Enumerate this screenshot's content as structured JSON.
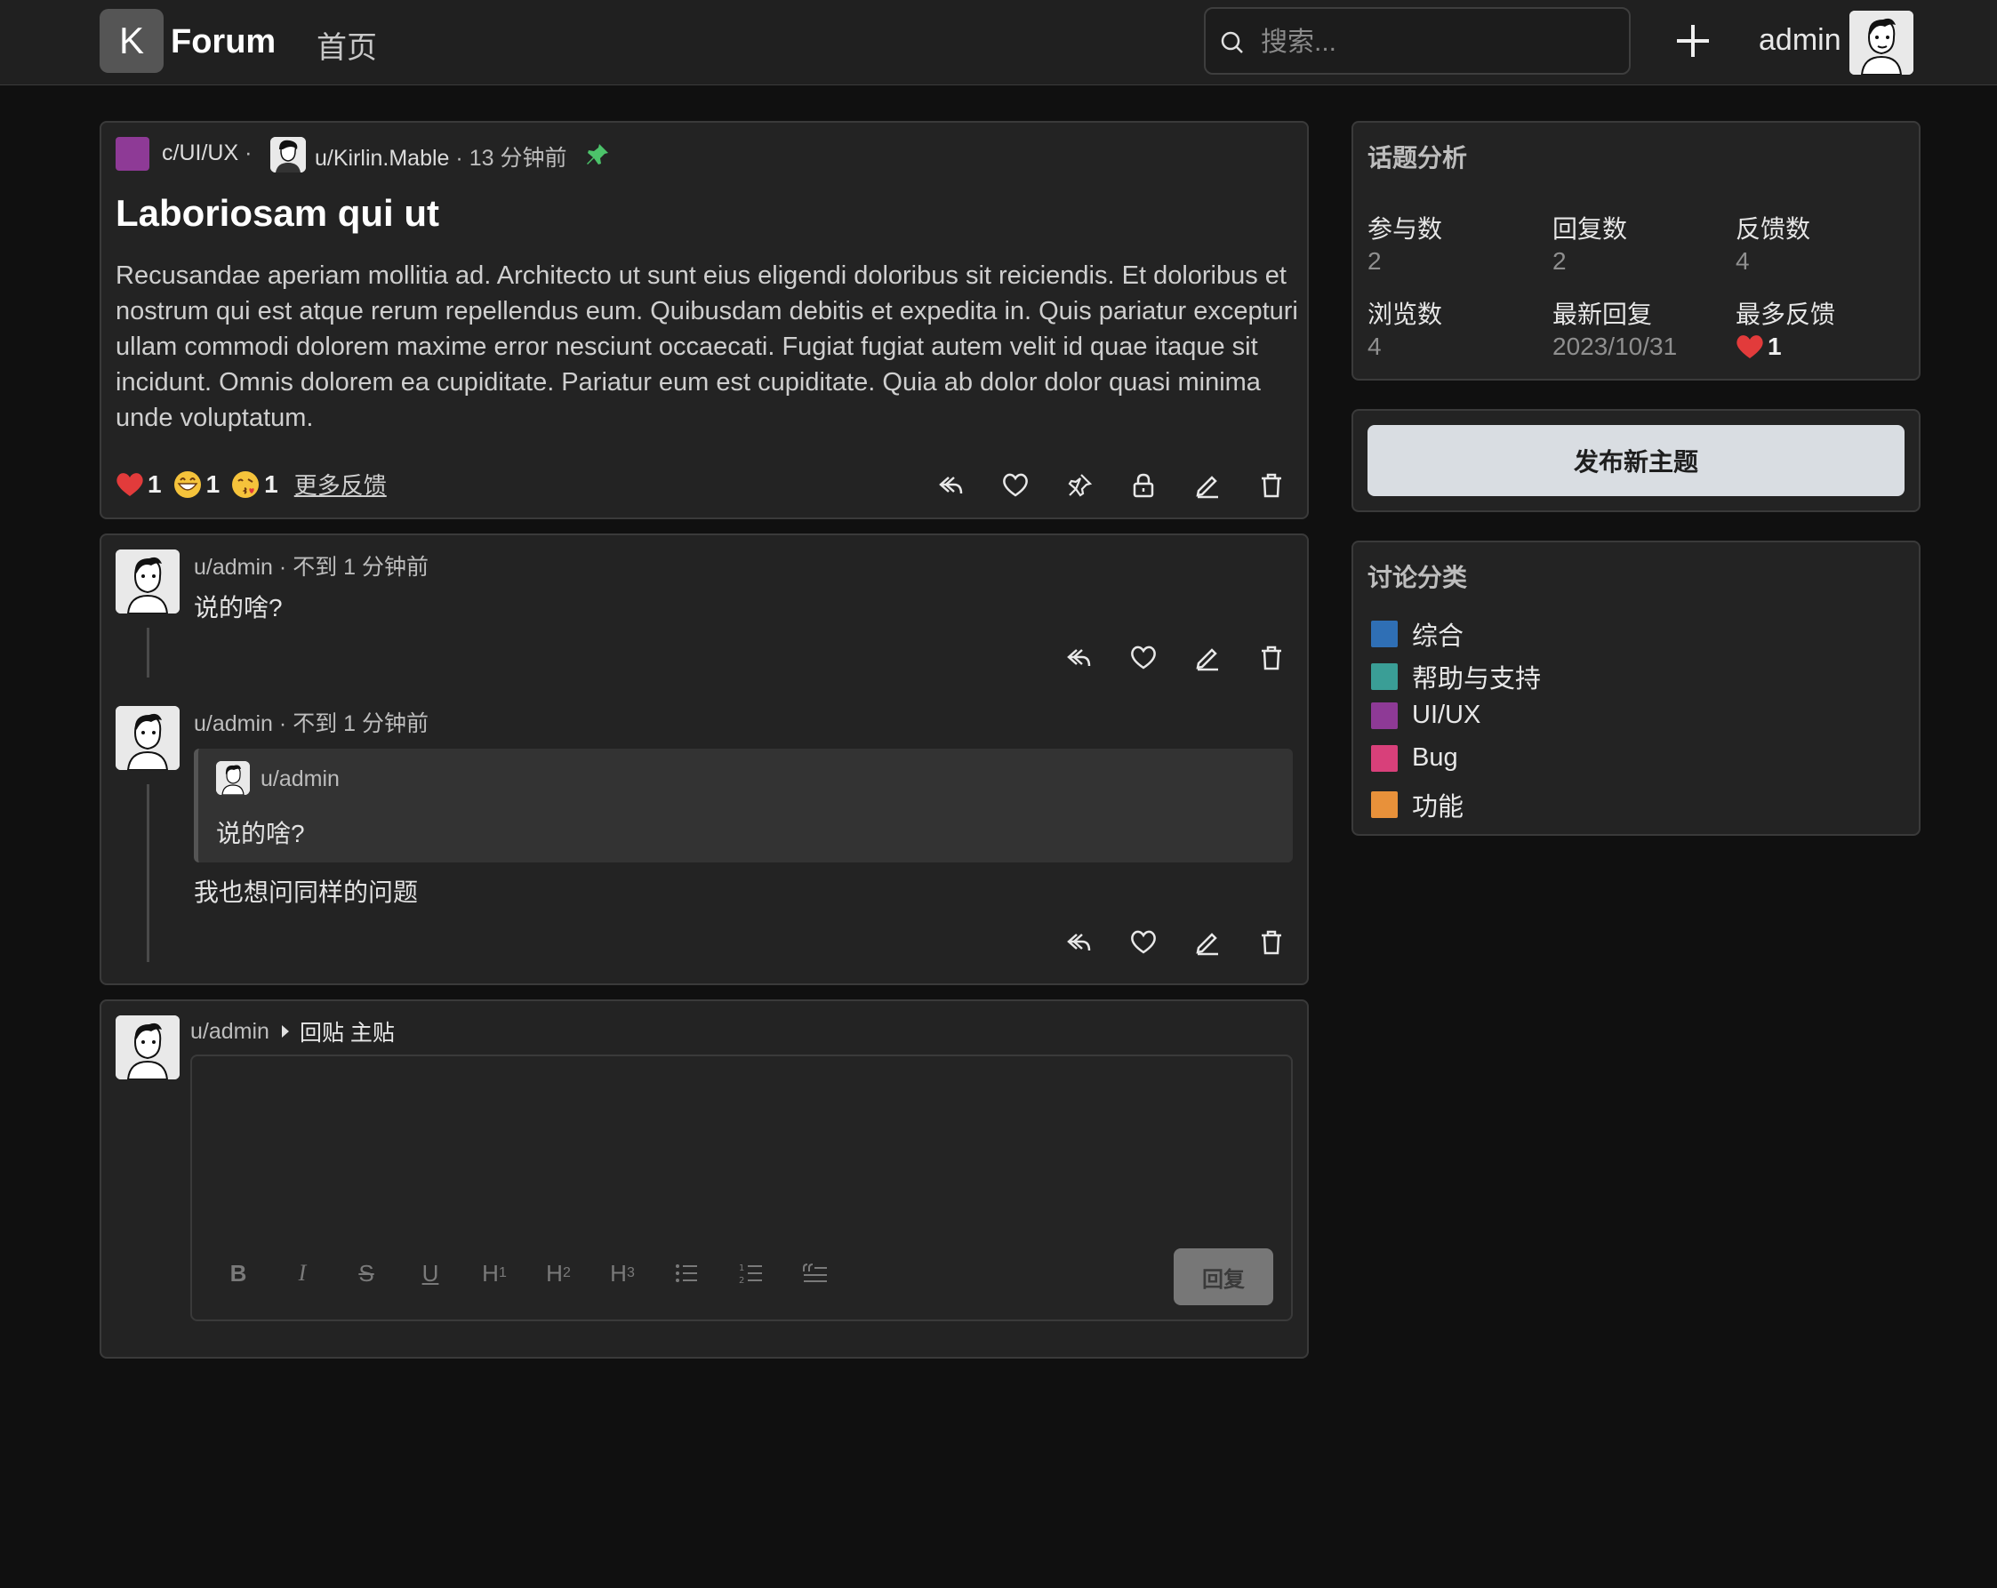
{
  "header": {
    "logo_letter": "K",
    "brand": "Forum",
    "nav_home": "首页",
    "search_placeholder": "搜索...",
    "username": "admin"
  },
  "post": {
    "community": "c/UI/UX",
    "community_color": "#8e3a96",
    "author": "u/Kirlin.Mable",
    "time": "13 分钟前",
    "pinned_color": "#4cc36a",
    "title": "Laboriosam qui ut",
    "body": "Recusandae aperiam mollitia ad. Architecto ut sunt eius eligendi doloribus sit reiciendis. Et doloribus et nostrum qui est atque rerum repellendus eum. Quibusdam debitis et expedita in. Quis pariatur excepturi ullam commodi dolorem maxime error nesciunt occaecati. Fugiat fugiat autem velit id quae itaque sit incidunt. Omnis dolorem ea cupiditate. Pariatur eum est cupiditate. Quia ab dolor dolor quasi minima unde voluptatum.",
    "reactions": [
      {
        "icon": "heart-emoji",
        "count": "1"
      },
      {
        "icon": "grin-emoji",
        "count": "1"
      },
      {
        "icon": "kiss-emoji",
        "count": "1"
      }
    ],
    "more_feedback": "更多反馈"
  },
  "comments": [
    {
      "author": "u/admin",
      "time": "不到 1 分钟前",
      "text": "说的啥?"
    },
    {
      "author": "u/admin",
      "time": "不到 1 分钟前",
      "quote_author": "u/admin",
      "quote_text": "说的啥?",
      "text": "我也想问同样的问题"
    }
  ],
  "reply_box": {
    "author": "u/admin",
    "target": "回贴 主贴",
    "submit_label": "回复",
    "toolbar": [
      "B",
      "I",
      "S",
      "U",
      "H1",
      "H2",
      "H3",
      "bullet-list",
      "ordered-list",
      "quote"
    ]
  },
  "sidebar": {
    "analysis_title": "话题分析",
    "stats": [
      {
        "label": "参与数",
        "value": "2"
      },
      {
        "label": "回复数",
        "value": "2"
      },
      {
        "label": "反馈数",
        "value": "4"
      },
      {
        "label": "浏览数",
        "value": "4"
      },
      {
        "label": "最新回复",
        "value": "2023/10/31"
      },
      {
        "label": "最多反馈",
        "value": "1"
      }
    ],
    "new_topic_label": "发布新主题",
    "categories_title": "讨论分类",
    "categories": [
      {
        "name": "综合",
        "color": "#2f6fb5"
      },
      {
        "name": "帮助与支持",
        "color": "#3a9e96"
      },
      {
        "name": "UI/UX",
        "color": "#8e3a96"
      },
      {
        "name": "Bug",
        "color": "#d8407a"
      },
      {
        "name": "功能",
        "color": "#e8913a"
      }
    ]
  }
}
